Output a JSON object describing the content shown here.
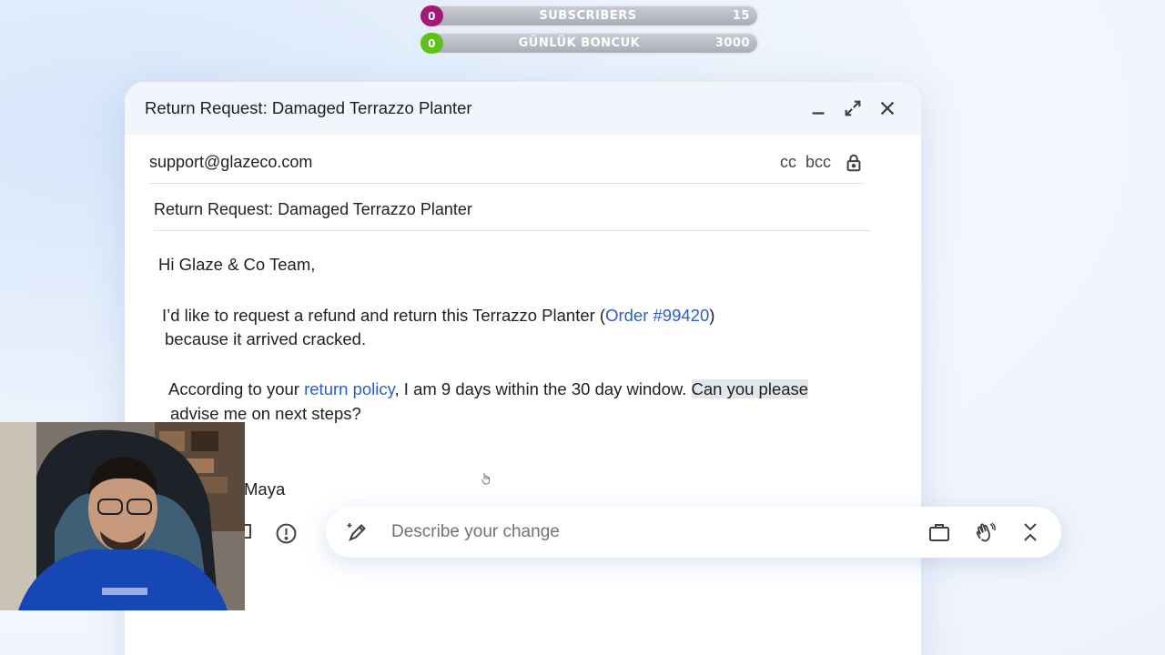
{
  "overlay": {
    "subscribers": {
      "badge": "0",
      "label": "SUBSCRIBERS",
      "count": "15"
    },
    "beads": {
      "badge": "0",
      "label": "GÜNLÜK BONCUK",
      "count": "3000"
    }
  },
  "compose": {
    "title": "Return Request: Damaged Terrazzo Planter",
    "to": "support@glazeco.com",
    "cc_label": "cc",
    "bcc_label": "bcc",
    "subject": "Return Request: Damaged Terrazzo Planter",
    "body": {
      "greeting": "Hi Glaze & Co Team,",
      "p1_before": "I’d like to request a refund and return this Terrazzo Planter (",
      "p1_link": "Order #99420",
      "p1_after": ")",
      "p1_line2": "because it arrived cracked.",
      "p2_before": "According to your ",
      "p2_link": "return policy",
      "p2_mid": ", I am 9 days within the 30 day window. ",
      "p2_highlight": "Can you please",
      "p2_line2": "advise me on next steps?",
      "signature": "Maya"
    }
  },
  "describe_bar": {
    "placeholder": "Describe your change"
  },
  "icons": {
    "minimize": "minimize-icon",
    "expand": "expand-icon",
    "close": "close-icon",
    "lock": "lock-icon",
    "pen": "pen-sparkle-icon",
    "briefcase": "briefcase-icon",
    "wave": "wave-hand-icon",
    "collapse": "collapse-icon",
    "info": "info-icon"
  }
}
